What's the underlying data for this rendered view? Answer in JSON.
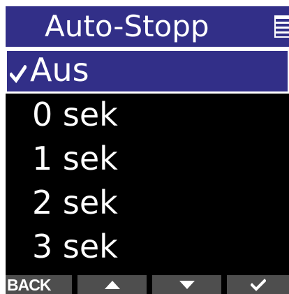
{
  "header": {
    "title": "Auto-Stopp",
    "icon": "menu-list-icon"
  },
  "options": {
    "selected_index": 0,
    "items": [
      {
        "label": "Aus",
        "selected": true
      },
      {
        "label": "0 sek",
        "selected": false
      },
      {
        "label": "1 sek",
        "selected": false
      },
      {
        "label": "2 sek",
        "selected": false
      },
      {
        "label": "3 sek",
        "selected": false
      }
    ]
  },
  "softkeys": {
    "back_label": "BACK",
    "up_icon": "up-arrow-icon",
    "down_icon": "down-arrow-icon",
    "confirm_icon": "check-icon"
  },
  "colors": {
    "accent": "#322f88",
    "background": "#000000",
    "text": "#ffffff",
    "softkey": "#4e4e4e"
  }
}
